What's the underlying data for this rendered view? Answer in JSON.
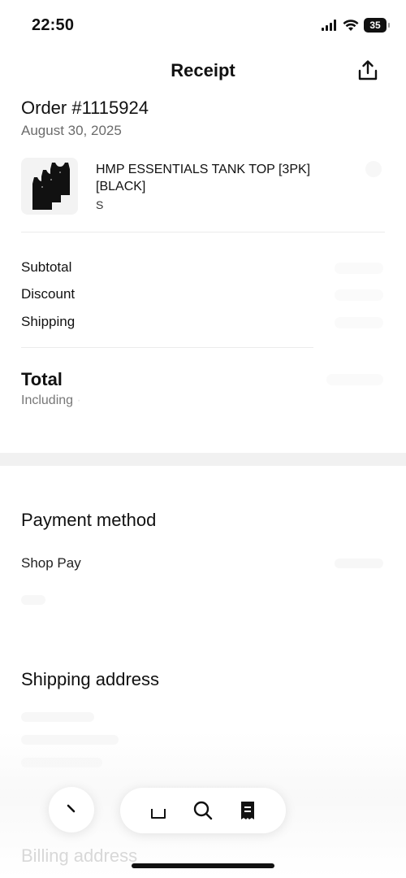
{
  "status_bar": {
    "time": "22:50",
    "battery": "35"
  },
  "header": {
    "title": "Receipt",
    "share_icon": "share-icon"
  },
  "order": {
    "number": "Order #1115924",
    "date": "August 30, 2025"
  },
  "product": {
    "name": "HMP ESSENTIALS TANK TOP [3PK] [BLACK]",
    "variant": "S"
  },
  "summary": {
    "subtotal_label": "Subtotal",
    "discount_label": "Discount",
    "shipping_label": "Shipping",
    "total_label": "Total",
    "including_label": "Including"
  },
  "payment": {
    "section_title": "Payment method",
    "method": "Shop Pay"
  },
  "shipping_address": {
    "section_title": "Shipping address"
  },
  "billing_address": {
    "section_title": "Billing address"
  },
  "bottom_nav": {
    "items": [
      "back-icon",
      "shop-bag-icon",
      "search-icon",
      "receipt-icon"
    ]
  },
  "colors": {
    "text": "#111111",
    "muted": "#6b6b6b",
    "band": "#f1f1f1"
  }
}
